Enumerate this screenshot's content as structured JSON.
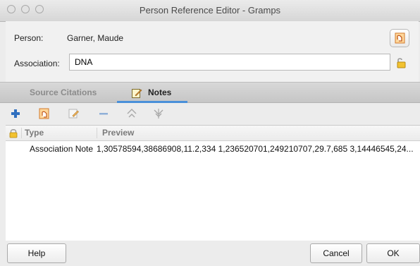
{
  "window": {
    "title": "Person Reference Editor - Gramps"
  },
  "form": {
    "person_label": "Person:",
    "person_value": "Garner, Maude",
    "association_label": "Association:",
    "association_value": "DNA"
  },
  "tabs": [
    {
      "label": "Source Citations",
      "active": false
    },
    {
      "label": "Notes",
      "active": true
    }
  ],
  "toolbar": {
    "icons": [
      "add-icon",
      "share-icon",
      "edit-icon",
      "remove-icon",
      "move-up-icon",
      "move-down-icon"
    ]
  },
  "table": {
    "columns": [
      "Type",
      "Preview"
    ],
    "rows": [
      {
        "type": "Association Note",
        "preview": "1,30578594,38686908,11.2,334 1,236520701,249210707,29.7,685 3,14446545,24..."
      }
    ]
  },
  "buttons": {
    "help": "Help",
    "cancel": "Cancel",
    "ok": "OK"
  },
  "colors": {
    "tab_accent": "#4a90d9",
    "add": "#2f6fbf",
    "share": "#e8923a"
  }
}
